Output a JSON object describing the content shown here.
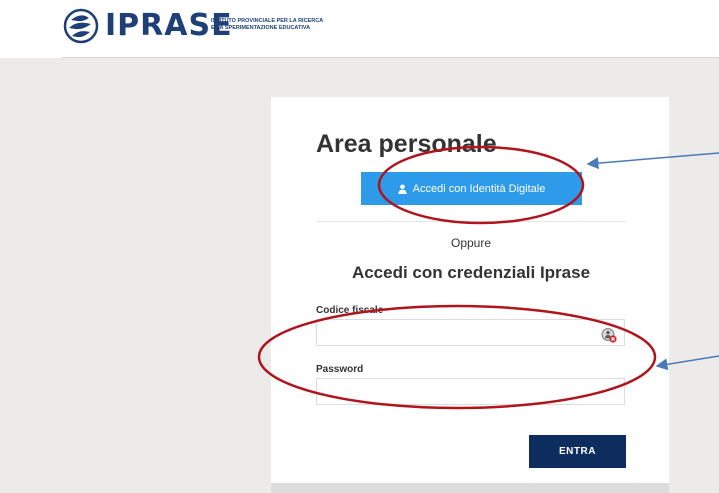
{
  "header": {
    "brand": "IPRASE",
    "subtitle_line1": "ISTITUTO PROVINCIALE PER LA RICERCA",
    "subtitle_line2": "E LA SPERIMENTAZIONE EDUCATIVA"
  },
  "login": {
    "title": "Area personale",
    "spid_button_label": "Accedi con Identità Digitale",
    "or_text": "Oppure",
    "credentials_title": "Accedi con credenziali Iprase",
    "fiscal_code_label": "Codice fiscale",
    "fiscal_code_value": "",
    "password_label": "Password",
    "password_value": "",
    "submit_label": "ENTRA"
  },
  "colors": {
    "brand": "#1f3f77",
    "spid_button": "#2e9bea",
    "submit_button": "#0d2d5e",
    "annotation_ellipse": "#b0141c",
    "annotation_arrow": "#4a7ab8",
    "backdrop": "#ecebea"
  },
  "icons": [
    "logo-icon",
    "user-icon",
    "identity-card-icon"
  ]
}
